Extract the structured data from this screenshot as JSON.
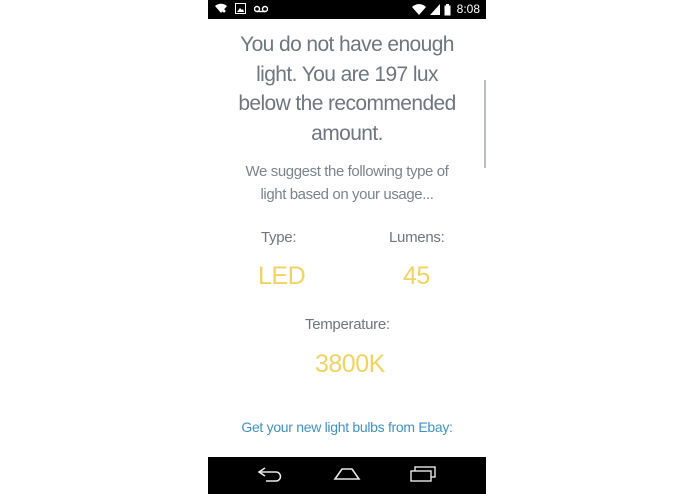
{
  "status_bar": {
    "time": "8:08",
    "icons": [
      "wifi-icon",
      "image-icon",
      "voicemail-icon",
      "wifi-signal-icon",
      "cell-signal-icon",
      "battery-icon"
    ]
  },
  "result": {
    "headline_lines": [
      "You do not have enough",
      "light. You are 197 lux",
      "below the recommended",
      "amount."
    ],
    "suggestion_lines": [
      "We suggest the following type of",
      "light based on your usage..."
    ]
  },
  "recommendation": {
    "type_label": "Type:",
    "type_value": "LED",
    "lumens_label": "Lumens:",
    "lumens_value": "45",
    "temperature_label": "Temperature:",
    "temperature_value": "3800K"
  },
  "ebay_link": "Get your new light bulbs from Ebay:",
  "colors": {
    "text": "#6e7680",
    "value": "#f3d360",
    "link": "#3f93c4",
    "bars": "#000000"
  },
  "nav_bar": {
    "icons": [
      "back-icon",
      "home-icon",
      "recent-apps-icon"
    ]
  }
}
